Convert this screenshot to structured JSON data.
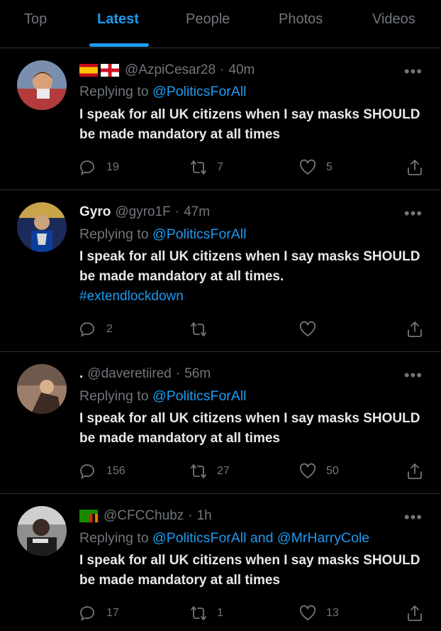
{
  "tabs": [
    {
      "label": "Top"
    },
    {
      "label": "Latest"
    },
    {
      "label": "People"
    },
    {
      "label": "Photos"
    },
    {
      "label": "Videos"
    }
  ],
  "tweets": [
    {
      "display_name": "",
      "handle": "@AzpiCesar28",
      "time": "40m",
      "reply_prefix": "Replying to ",
      "reply_to_1": "@PoliticsForAll",
      "reply_joiner": "",
      "reply_to_2": "",
      "text": "I speak for all UK citizens when I say masks SHOULD be made mandatory at all times",
      "hashtag": "",
      "replies": "19",
      "retweets": "7",
      "likes": "5"
    },
    {
      "display_name": "Gyro",
      "handle": "@gyro1F",
      "time": "47m",
      "reply_prefix": "Replying to ",
      "reply_to_1": "@PoliticsForAll",
      "reply_joiner": "",
      "reply_to_2": "",
      "text": "I speak for all UK citizens when I say masks SHOULD be made mandatory at all times.",
      "hashtag": "#extendlockdown",
      "replies": "2",
      "retweets": "",
      "likes": ""
    },
    {
      "display_name": ".",
      "handle": "@daveretiired",
      "time": "56m",
      "reply_prefix": "Replying to ",
      "reply_to_1": "@PoliticsForAll",
      "reply_joiner": "",
      "reply_to_2": "",
      "text": "I speak for all UK citizens when I say masks SHOULD be made mandatory at all times",
      "hashtag": "",
      "replies": "156",
      "retweets": "27",
      "likes": "50"
    },
    {
      "display_name": "",
      "handle": "@CFCChubz",
      "time": "1h",
      "reply_prefix": "Replying to ",
      "reply_to_1": "@PoliticsForAll",
      "reply_joiner": " and ",
      "reply_to_2": "@MrHarryCole",
      "text": "I speak for all UK citizens when I say masks SHOULD be made mandatory at all times",
      "hashtag": "",
      "replies": "17",
      "retweets": "1",
      "likes": "13"
    }
  ],
  "separator": "·",
  "more_icon": "more-horizontal-icon",
  "icons": [
    "reply-icon",
    "retweet-icon",
    "like-icon",
    "share-icon"
  ],
  "colors": {
    "accent": "#1d9bf0",
    "muted": "#71767b",
    "background": "#000000",
    "text": "#e7e9ea"
  }
}
